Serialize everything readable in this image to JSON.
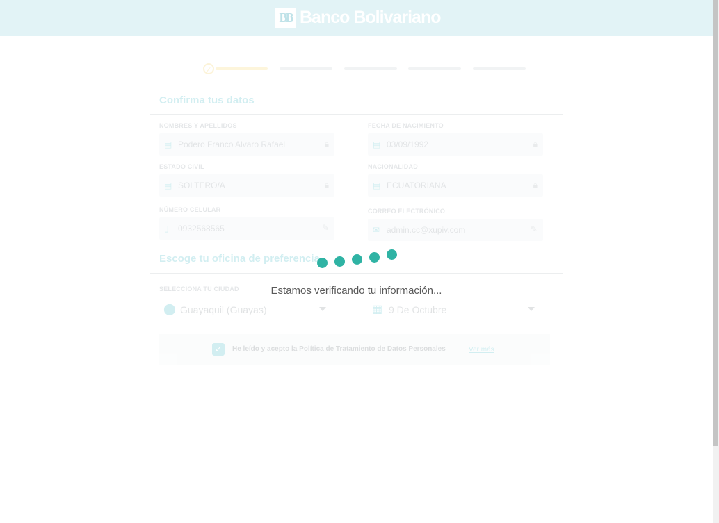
{
  "header": {
    "brand_mark": "BB",
    "brand_name": "Banco Bolivariano"
  },
  "progress": {
    "completed_steps": 1,
    "total_steps": 5
  },
  "section_personal": {
    "title": "Confirma tus datos"
  },
  "fields": {
    "names": {
      "label": "NOMBRES Y APELLIDOS",
      "value": "Podero Franco Alvaro Rafael",
      "icon": "id-card-icon"
    },
    "birthdate": {
      "label": "FECHA DE NACIMIENTO",
      "value": "03/09/1992",
      "icon": "id-card-icon"
    },
    "civil_status": {
      "label": "ESTADO CIVIL",
      "value": "SOLTERO/A",
      "icon": "id-card-icon"
    },
    "nationality": {
      "label": "NACIONALIDAD",
      "value": "ECUATORIANA",
      "icon": "id-card-icon"
    },
    "phone": {
      "label": "NÚMERO CELULAR",
      "value": "0932568565",
      "icon": "phone-icon"
    },
    "email": {
      "label": "CORREO ELECTRÓNICO",
      "value": "admin.cc@xupiv.com",
      "icon": "mail-icon"
    }
  },
  "section_office": {
    "title": "Escoge tu oficina de preferencia"
  },
  "city": {
    "label": "SELECCIONA TU CIUDAD",
    "value": "Guayaquil (Guayas)"
  },
  "office": {
    "value": "9 De Octubre"
  },
  "consent": {
    "text": "He leído y acepto la Política de Tratamiento de Datos Personales",
    "link": "Ver más"
  },
  "loading": {
    "message": "Estamos verificando tu información..."
  },
  "colors": {
    "accent": "#0aa7b7",
    "loader": "#2fb3a4",
    "progress": "#f6c93b",
    "header_bg": "#e2f3f6"
  }
}
